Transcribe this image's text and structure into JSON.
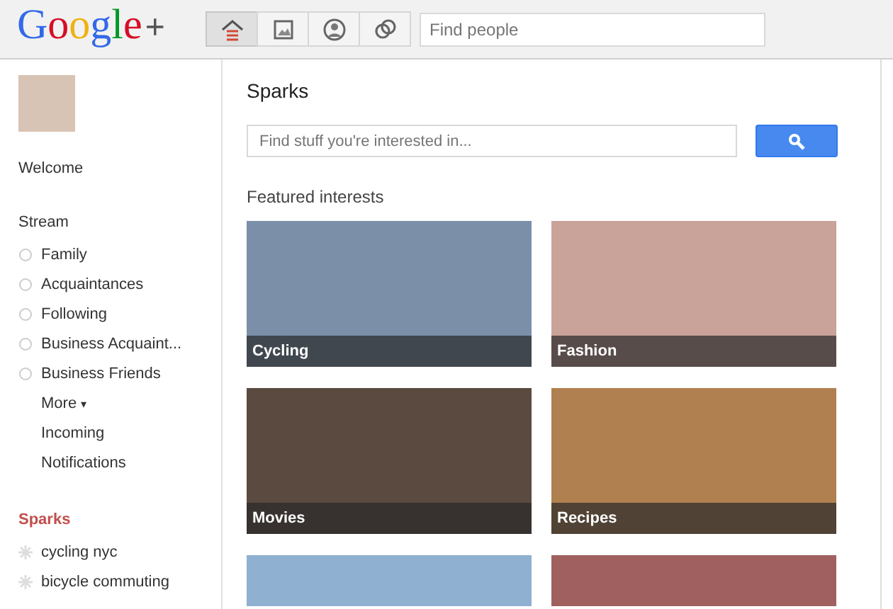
{
  "header": {
    "logo": {
      "letters": [
        {
          "text": "G",
          "color": "#3369e8"
        },
        {
          "text": "o",
          "color": "#d50f25"
        },
        {
          "text": "o",
          "color": "#eeb211"
        },
        {
          "text": "g",
          "color": "#3369e8"
        },
        {
          "text": "l",
          "color": "#009925"
        },
        {
          "text": "e",
          "color": "#d50f25"
        }
      ],
      "plus": "+"
    },
    "nav": [
      {
        "kind": "home",
        "selected": true
      },
      {
        "kind": "photos",
        "selected": false
      },
      {
        "kind": "profile",
        "selected": false
      },
      {
        "kind": "circles",
        "selected": false
      }
    ],
    "search": {
      "placeholder": "Find people"
    }
  },
  "sidebar": {
    "welcome": "Welcome",
    "stream": {
      "title": "Stream",
      "items": [
        {
          "kind": "circle",
          "label": "Family"
        },
        {
          "kind": "circle",
          "label": "Acquaintances"
        },
        {
          "kind": "circle",
          "label": "Following"
        },
        {
          "kind": "circle",
          "label": "Business Acquaint..."
        },
        {
          "kind": "circle",
          "label": "Business Friends"
        },
        {
          "kind": "menu",
          "label": "More",
          "caret": "▾"
        },
        {
          "kind": "link",
          "label": "Incoming"
        },
        {
          "kind": "link",
          "label": "Notifications"
        }
      ]
    },
    "sparks": {
      "title": "Sparks",
      "items": [
        {
          "label": "cycling nyc"
        },
        {
          "label": "bicycle commuting"
        }
      ]
    }
  },
  "main": {
    "title": "Sparks",
    "search": {
      "placeholder": "Find stuff you're interested in..."
    },
    "featured_title": "Featured interests",
    "tiles": [
      {
        "kind": "captioned",
        "label": "Cycling"
      },
      {
        "kind": "captioned",
        "label": "Fashion"
      },
      {
        "kind": "captioned",
        "label": "Movies"
      },
      {
        "kind": "captioned",
        "label": "Recipes"
      },
      {
        "kind": "photo"
      },
      {
        "kind": "photo"
      }
    ]
  }
}
